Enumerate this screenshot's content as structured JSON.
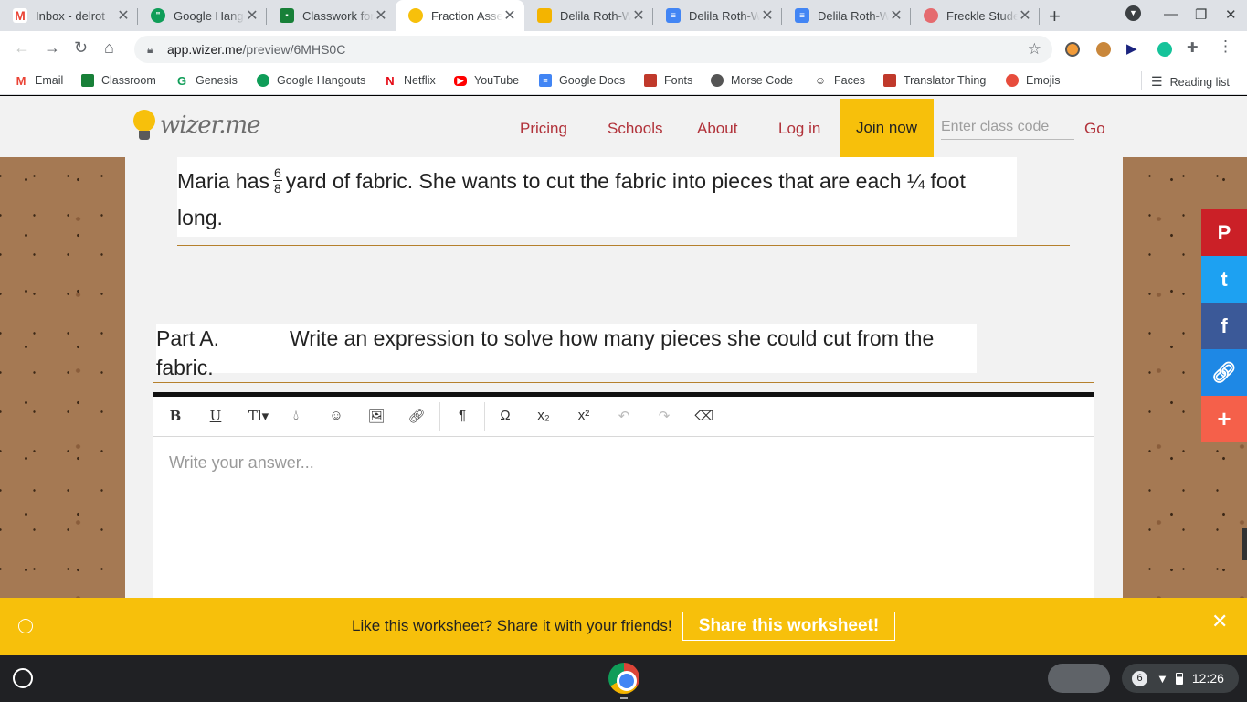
{
  "browser": {
    "tabs": [
      {
        "title": "Inbox - delrot",
        "icon": "gmail-icon",
        "color": "#ea4335"
      },
      {
        "title": "Google Hangouts",
        "icon": "hangouts-icon",
        "color": "#0f9d58"
      },
      {
        "title": "Classwork for",
        "icon": "classroom-icon",
        "color": "#188038"
      },
      {
        "title": "Fraction Assessment",
        "icon": "wizer-icon",
        "color": "#f7c00b"
      },
      {
        "title": "Delila Roth-W",
        "icon": "slides-icon",
        "color": "#f4b400"
      },
      {
        "title": "Delila Roth-W",
        "icon": "docs-icon",
        "color": "#4285f4"
      },
      {
        "title": "Delila Roth-W",
        "icon": "docs-icon",
        "color": "#4285f4"
      },
      {
        "title": "Freckle Student",
        "icon": "freckle-icon",
        "color": "#e56b6f"
      }
    ],
    "url_host": "app.wizer.me",
    "url_path": "/preview/6MHS0C",
    "bookmarks": [
      {
        "label": "Email",
        "icon": "gmail-icon",
        "color": "#ea4335"
      },
      {
        "label": "Classroom",
        "icon": "classroom-icon",
        "color": "#188038"
      },
      {
        "label": "Genesis",
        "icon": "genesis-icon",
        "color": "#0f9d58"
      },
      {
        "label": "Google Hangouts",
        "icon": "hangouts-icon",
        "color": "#0f9d58"
      },
      {
        "label": "Netflix",
        "icon": "netflix-icon",
        "color": "#e50914"
      },
      {
        "label": "YouTube",
        "icon": "youtube-icon",
        "color": "#ff0000"
      },
      {
        "label": "Google Docs",
        "icon": "docs-icon",
        "color": "#4285f4"
      },
      {
        "label": "Fonts",
        "icon": "fonts-icon",
        "color": "#c0392b"
      },
      {
        "label": "Morse Code",
        "icon": "morse-icon",
        "color": "#555555"
      },
      {
        "label": "Faces",
        "icon": "faces-icon",
        "color": "#333333"
      },
      {
        "label": "Translator Thing",
        "icon": "translator-icon",
        "color": "#c0392b"
      },
      {
        "label": "Emojis",
        "icon": "emojis-icon",
        "color": "#e74c3c"
      }
    ],
    "reading_list": "Reading list"
  },
  "site": {
    "logo_text": "wizer.me",
    "nav": {
      "pricing": "Pricing",
      "schools": "Schools",
      "about": "About",
      "login": "Log in",
      "join": "Join now"
    },
    "class_code_placeholder": "Enter class code",
    "go": "Go",
    "accent": "#f7c00b",
    "link_color": "#b1323a"
  },
  "question": {
    "prefix": "Maria has",
    "frac_num": "6",
    "frac_den": "8",
    "suffix": "yard of fabric. She wants to cut the fabric into pieces that are each ¼ foot long."
  },
  "part_a": {
    "label": "Part A.",
    "text": "Write an expression to solve how many pieces she could cut from the fabric."
  },
  "editor": {
    "placeholder": "Write your answer...",
    "tools": [
      "bold-icon",
      "underline-icon",
      "text-size-icon",
      "color-icon",
      "emoji-icon",
      "image-icon",
      "link-icon",
      "paragraph-icon",
      "omega-icon",
      "subscript-icon",
      "superscript-icon",
      "undo-icon",
      "redo-icon",
      "eraser-icon"
    ]
  },
  "banner": {
    "message": "Like this worksheet? Share it with your friends!",
    "button": "Share this worksheet!"
  },
  "social": [
    {
      "icon": "pinterest-icon",
      "color": "#cb2027"
    },
    {
      "icon": "twitter-icon",
      "color": "#1da1f2"
    },
    {
      "icon": "facebook-icon",
      "color": "#3b5998"
    },
    {
      "icon": "copy-link-icon",
      "color": "#1e88e5"
    },
    {
      "icon": "more-share-icon",
      "color": "#f5604a"
    }
  ],
  "taskbar": {
    "notifications": "6",
    "time": "12:26"
  }
}
